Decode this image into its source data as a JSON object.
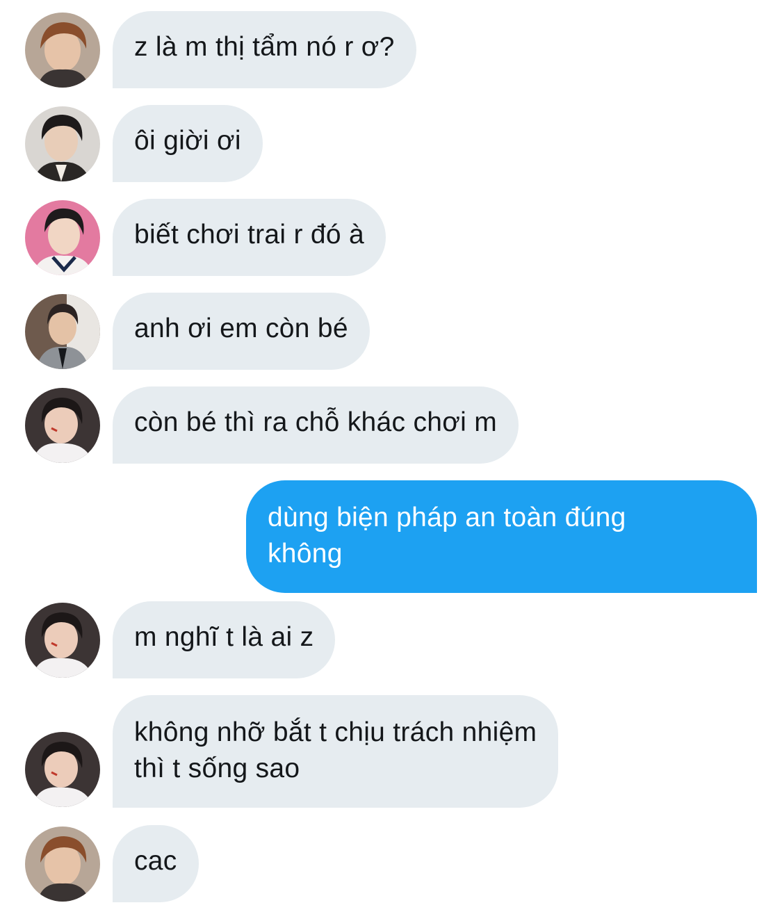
{
  "messages": [
    {
      "sender": "incoming",
      "avatar": "avatar-1-icon",
      "text": "z là m thị tẩm nó r ơ?"
    },
    {
      "sender": "incoming",
      "avatar": "avatar-2-icon",
      "text": "ôi giời ơi"
    },
    {
      "sender": "incoming",
      "avatar": "avatar-3-icon",
      "text": "biết chơi trai r đó à"
    },
    {
      "sender": "incoming",
      "avatar": "avatar-4-icon",
      "text": "anh ơi em còn bé"
    },
    {
      "sender": "incoming",
      "avatar": "avatar-5-icon",
      "text": "còn bé thì ra chỗ khác chơi m"
    },
    {
      "sender": "outgoing",
      "lines": [
        "dùng biện pháp an toàn đúng",
        "không"
      ]
    },
    {
      "sender": "incoming",
      "avatar": "avatar-5-icon",
      "text": "m nghĩ t là ai z"
    },
    {
      "sender": "incoming",
      "avatar": "avatar-5-icon",
      "lines": [
        "không nhỡ bắt t chịu trách nhiệm",
        "thì t sống sao"
      ]
    },
    {
      "sender": "incoming",
      "avatar": "avatar-1-icon",
      "text": "cac"
    }
  ],
  "colors": {
    "incoming_bubble": "#e6ecf0",
    "outgoing_bubble": "#1da1f2",
    "incoming_text": "#14171a",
    "outgoing_text": "#ffffff"
  }
}
